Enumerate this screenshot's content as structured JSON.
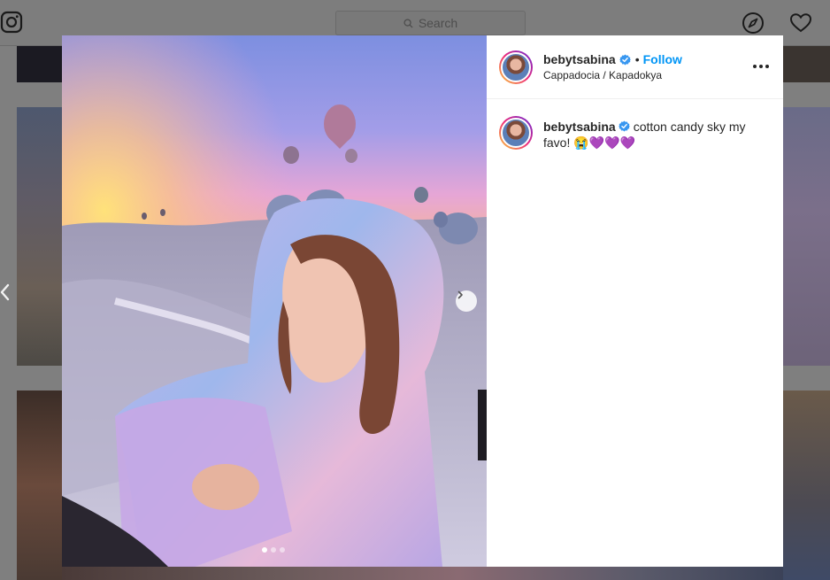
{
  "header": {
    "search_placeholder": "Search"
  },
  "post": {
    "username": "bebytsabina",
    "separator": "•",
    "follow_label": "Follow",
    "location": "Cappadocia / Kapadokya",
    "caption_text": "cotton candy sky my favo!",
    "caption_emoji": "😭💜💜💜",
    "carousel": {
      "total": 3,
      "current": 1
    }
  },
  "colors": {
    "follow": "#0095f6",
    "verified": "#3897f0",
    "overlay": "#7f7f7f"
  },
  "icons": [
    "instagram-logo-icon",
    "search-icon",
    "compass-icon",
    "heart-icon",
    "chevron-left-icon",
    "chevron-right-icon",
    "verified-badge-icon",
    "more-options-icon"
  ]
}
